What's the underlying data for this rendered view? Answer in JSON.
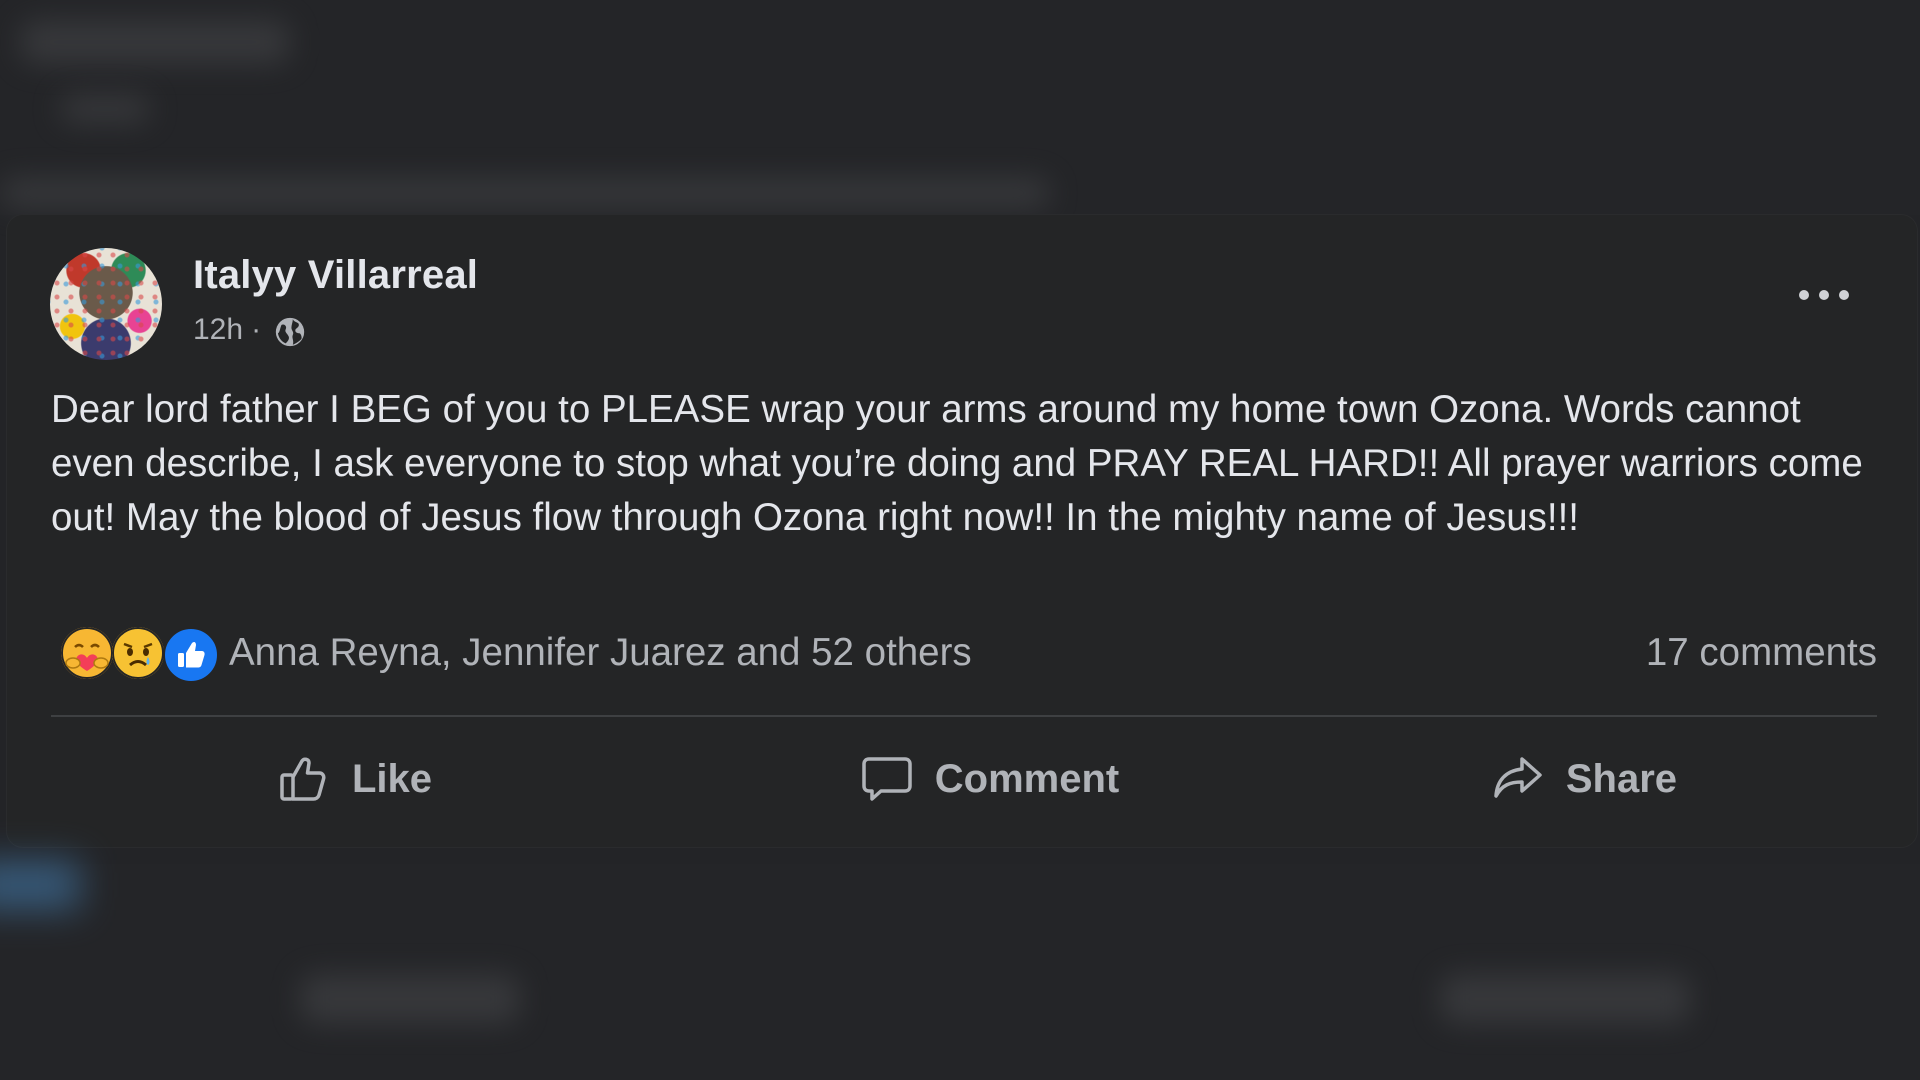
{
  "post": {
    "author": "Italyy Villarreal",
    "timestamp": "12h",
    "separator": "·",
    "privacy_icon": "globe-icon",
    "body": "Dear lord father I BEG of you to PLEASE wrap your arms around my home town Ozona. Words cannot even describe, I ask everyone to stop what you’re doing and PRAY REAL HARD!! All prayer warriors come out! May the blood of Jesus flow through Ozona right now!! In the mighty name of Jesus!!!",
    "reactions": {
      "icons": [
        "care-reaction-icon",
        "sad-reaction-icon",
        "like-reaction-icon"
      ],
      "names": "Anna Reyna, Jennifer Juarez and 52 others"
    },
    "comments_count": "17 comments",
    "actions": {
      "like": "Like",
      "comment": "Comment",
      "share": "Share"
    }
  },
  "colors": {
    "background": "#232427",
    "card": "#242526",
    "primary_text": "#e4e6eb",
    "secondary_text": "#b0b3b8",
    "like_blue": "#1877f2",
    "divider": "#3e4042"
  }
}
